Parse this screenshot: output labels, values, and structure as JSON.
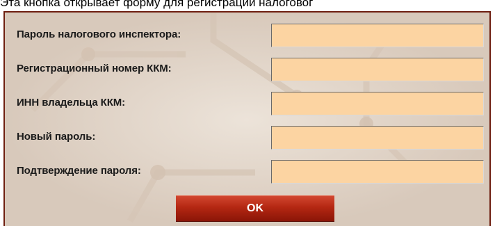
{
  "caption": "Эта кнопка открывает форму для регистрации налоговог",
  "form": {
    "fields": [
      {
        "label": "Пароль налогового инспектора:",
        "value": ""
      },
      {
        "label": "Регистрационный номер ККМ:",
        "value": ""
      },
      {
        "label": "ИНН владельца ККМ:",
        "value": ""
      },
      {
        "label": "Новый пароль:",
        "value": ""
      },
      {
        "label": "Подтверждение пароля:",
        "value": ""
      }
    ],
    "ok_label": "OK"
  },
  "colors": {
    "panel_background": "#e3d7cb",
    "panel_border": "#6e1e10",
    "field_background": "#fcd4a2",
    "button_red": "#b42712",
    "button_text": "#ffffff"
  }
}
